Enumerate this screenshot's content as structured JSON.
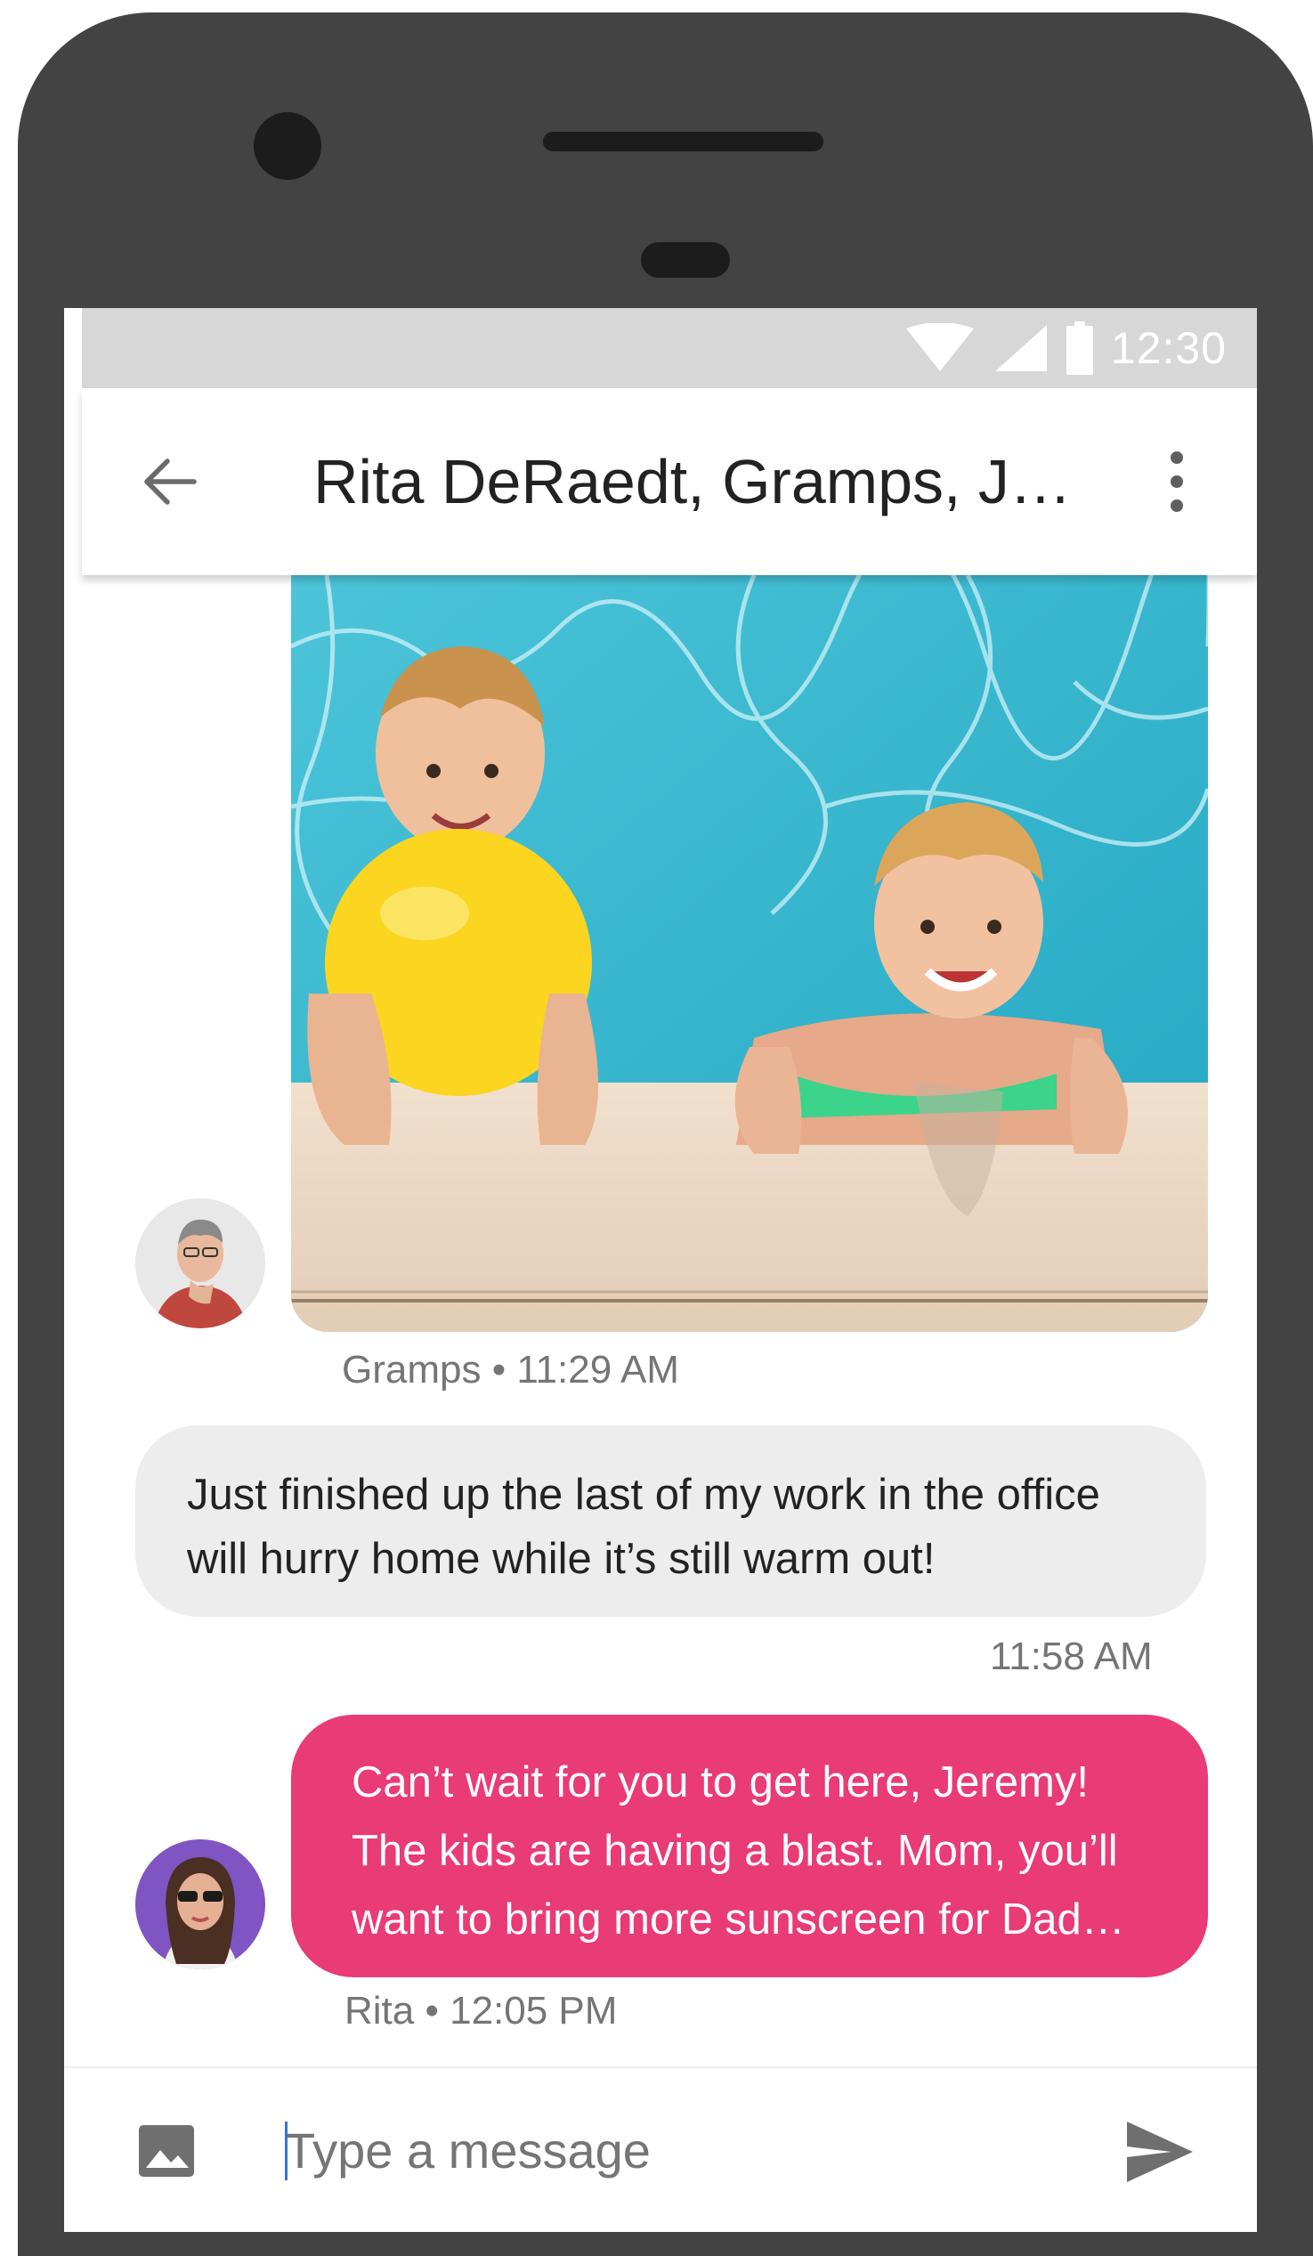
{
  "status_bar": {
    "time": "12:30",
    "icons": [
      "wifi-icon",
      "signal-icon",
      "battery-icon"
    ]
  },
  "header": {
    "title": "Rita DeRaedt, Gramps, J…",
    "back_icon": "arrow-back-icon",
    "menu_icon": "more-vert-icon"
  },
  "messages": [
    {
      "type": "image",
      "sender": "Gramps",
      "meta": "Gramps • 11:29 AM"
    },
    {
      "type": "text",
      "direction": "incoming",
      "text": "Just finished up the last of my work in the office will hurry home while it’s still warm out!",
      "meta": "11:58 AM"
    },
    {
      "type": "text",
      "direction": "outgoing",
      "sender": "Rita",
      "text": "Can’t wait for you to get here, Jeremy! The kids are having a blast. Mom, you’ll want to bring more sunscreen for Dad…",
      "meta": "Rita • 12:05 PM"
    }
  ],
  "composer": {
    "placeholder": "Type a message",
    "value": "",
    "attach_icon": "image-icon",
    "send_icon": "send-icon"
  },
  "colors": {
    "outgoing_bubble": "#e93b76",
    "incoming_bubble": "#ededed",
    "phone_frame": "#434343",
    "status_bar": "#d7d7d7"
  }
}
